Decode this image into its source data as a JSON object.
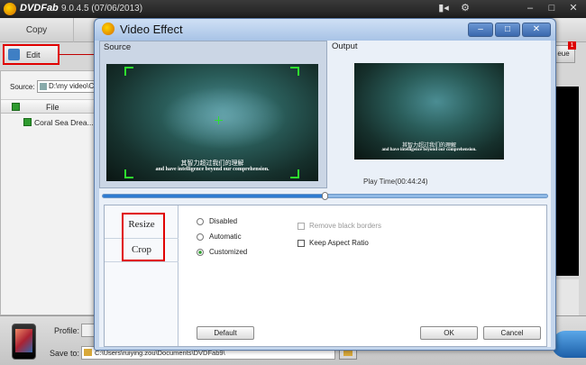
{
  "app": {
    "brand": "DVDFab",
    "version": "9.0.4.5 (07/06/2013)",
    "title_controls": [
      "▮◂",
      "⚙",
      "–",
      "□",
      "✕"
    ]
  },
  "menubar": {
    "copy_tab": "Copy",
    "queue_label": "eue",
    "queue_badge": "1"
  },
  "toolbar": {
    "edit_label": "Edit"
  },
  "source": {
    "label": "Source:",
    "path": "D:\\my video\\Co"
  },
  "file_list": {
    "header": "File",
    "rows": [
      {
        "name": "Coral Sea Drea..."
      }
    ]
  },
  "bottom": {
    "profile_label": "Profile:",
    "saveto_label": "Save to:",
    "saveto_path": "C:\\Users\\ruiying.zou\\Documents\\DVDFab9\\"
  },
  "dialog": {
    "title": "Video Effect",
    "controls": {
      "minimize": "–",
      "maximize": "□",
      "close": "✕"
    },
    "source_title": "Source",
    "output_title": "Output",
    "subtitle_cn": "其智力超过我们的理解",
    "subtitle_en": "and have intelligence beyond our comprehension.",
    "play_time": "Play Time(00:44:24)",
    "slider_progress": 0.5,
    "tabs": {
      "resize": "Resize",
      "crop": "Crop"
    },
    "options": {
      "disabled": "Disabled",
      "automatic": "Automatic",
      "customized": "Customized",
      "selected": "customized",
      "remove_black_borders": "Remove black borders",
      "keep_aspect_ratio": "Keep Aspect Ratio"
    },
    "buttons": {
      "default": "Default",
      "ok": "OK",
      "cancel": "Cancel"
    }
  },
  "colors": {
    "highlight_red": "#e00000",
    "crop_green": "#2ee02e",
    "dialog_blue": "#c3d5ec",
    "slider_blue": "#2e7bd1"
  }
}
